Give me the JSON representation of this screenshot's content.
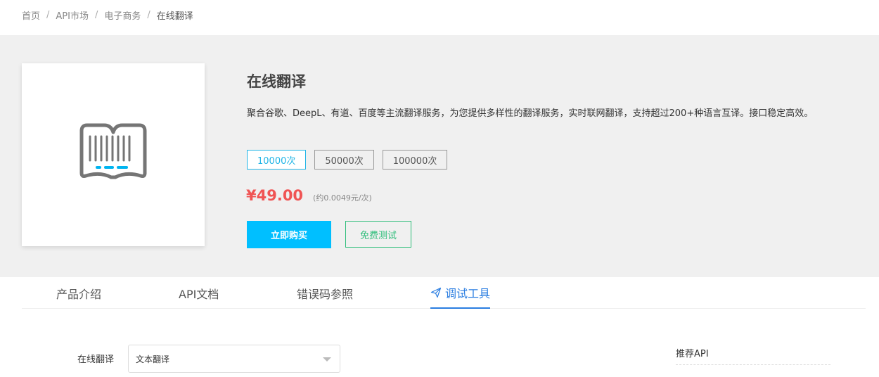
{
  "breadcrumb": [
    "首页",
    "API市场",
    "电子商务",
    "在线翻译"
  ],
  "breadcrumb_separator": "/",
  "product": {
    "title": "在线翻译",
    "description": "聚合谷歌、DeepL、有道、百度等主流翻译服务，为您提供多样性的翻译服务，实时联网翻译，支持超过200+种语言互译。接口稳定高效。",
    "logo_icon": "book-barcode-icon",
    "plans": [
      {
        "label": "10000次",
        "selected": true
      },
      {
        "label": "50000次",
        "selected": false
      },
      {
        "label": "100000次",
        "selected": false
      }
    ],
    "price": "¥49.00",
    "unit_price": "(约0.0049元/次)",
    "buy_label": "立即购买",
    "trial_label": "免费测试"
  },
  "tabs": [
    {
      "label": "产品介绍",
      "active": false
    },
    {
      "label": "API文档",
      "active": false
    },
    {
      "label": "错误码参照",
      "active": false
    },
    {
      "label": "调试工具",
      "active": true,
      "icon": "paper-plane-icon"
    }
  ],
  "debug_form": {
    "label": "在线翻译",
    "selected_option": "文本翻译"
  },
  "recommend": {
    "title": "推荐API"
  },
  "colors": {
    "accent": "#00bfff",
    "price": "#f05454",
    "trial": "#2ebd7a",
    "tab_active": "#2a7de1",
    "hero_bg": "#f0f0f0"
  }
}
